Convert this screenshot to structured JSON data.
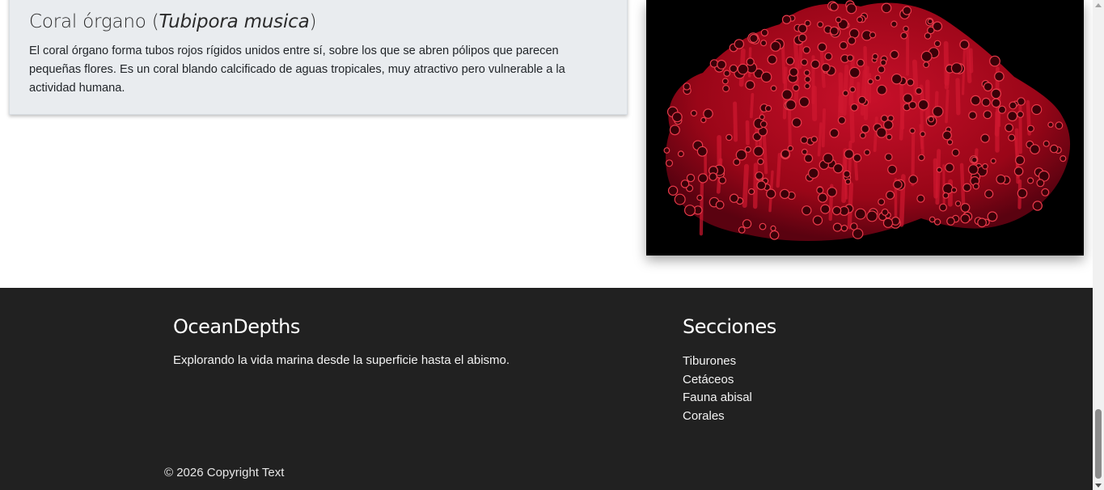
{
  "card": {
    "title_common": "Coral órgano (",
    "title_scientific": "Tubipora musica",
    "title_close": ")",
    "description": "El coral órgano forma tubos rojos rígidos unidos entre sí, sobre los que se abren pólipos que parecen pequeñas flores. Es un coral blando calcificado de aguas tropicales, muy atractivo pero vulnerable a la actividad humana."
  },
  "image": {
    "subject": "coral órgano rojo sobre fondo negro",
    "colors": {
      "background": "#000000",
      "coral": "#b0081c",
      "coral_highlight": "#e83a4a"
    }
  },
  "footer": {
    "brand": "OceanDepths",
    "tagline": "Explorando la vida marina desde la superficie hasta el abismo.",
    "sections_title": "Secciones",
    "sections": [
      "Tiburones",
      "Cetáceos",
      "Fauna abisal",
      "Corales"
    ],
    "copyright": "© 2026 Copyright Text",
    "colors": {
      "background": "#212121",
      "text": "#ffffff"
    }
  }
}
